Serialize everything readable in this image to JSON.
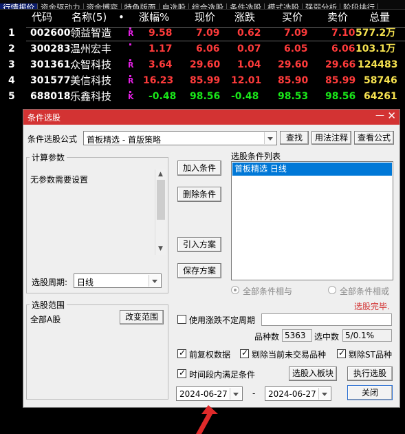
{
  "top_tabs": [
    "行情报价",
    "资金驱动力",
    "资金博弈",
    "特色版面",
    "自选股",
    "综合选股",
    "条件选股",
    "模式选股",
    "强弱分析",
    "阶段排行"
  ],
  "quote_table": {
    "headers": {
      "code": "代码",
      "name": "名称(5)",
      "dot": "•",
      "chg_pct": "涨幅%",
      "price": "现价",
      "change": "涨跌",
      "bid": "买价",
      "ask": "卖价",
      "volume": "总量"
    },
    "rows": [
      {
        "idx": "1",
        "code": "002600",
        "name": "领益智造",
        "flag": "R",
        "chg_pct": "9.58",
        "price": "7.09",
        "change": "0.62",
        "bid": "7.09",
        "ask": "7.10",
        "volume": "577.2万"
      },
      {
        "idx": "2",
        "code": "300283",
        "name": "温州宏丰",
        "flag": "",
        "chg_pct": "1.17",
        "price": "6.06",
        "change": "0.07",
        "bid": "6.05",
        "ask": "6.06",
        "volume": "103.1万"
      },
      {
        "idx": "3",
        "code": "301361",
        "name": "众智科技",
        "flag": "R",
        "chg_pct": "3.64",
        "price": "29.60",
        "change": "1.04",
        "bid": "29.60",
        "ask": "29.66",
        "volume": "124483"
      },
      {
        "idx": "4",
        "code": "301577",
        "name": "美信科技",
        "flag": "R",
        "chg_pct": "16.23",
        "price": "85.99",
        "change": "12.01",
        "bid": "85.90",
        "ask": "85.99",
        "volume": "58746"
      },
      {
        "idx": "5",
        "code": "688018",
        "name": "乐鑫科技",
        "flag": "K",
        "chg_pct": "-0.48",
        "price": "98.56",
        "change": "-0.48",
        "bid": "98.53",
        "ask": "98.56",
        "volume": "64261"
      }
    ]
  },
  "dialog": {
    "title": "条件选股",
    "minimize": "—",
    "close": "✕",
    "formula_label": "条件选股公式",
    "formula_value": "首板精选  -  首版策略",
    "find_button": "查找",
    "usage_button": "用法注释",
    "view_formula_button": "查看公式",
    "params_group": "计算参数",
    "params_text": "无参数需要设置",
    "period_label": "选股周期:",
    "period_value": "日线",
    "add_condition": "加入条件",
    "delete_condition": "删除条件",
    "import_plan": "引入方案",
    "save_plan": "保存方案",
    "condition_list_label": "选股条件列表",
    "condition_list": [
      "首板精选  日线"
    ],
    "radio_and": "全部条件相与",
    "radio_or": "全部条件相或",
    "status": "选股完毕.",
    "range_group": "选股范围",
    "range_value": "全部A股",
    "change_range": "改变范围",
    "use_uncertain_period": "使用涨跌不定周期",
    "count_label": "品种数",
    "count_value": "5363",
    "selected_label": "选中数",
    "selected_value": "5/0.1%",
    "adjust_label": "前复权数据",
    "exclude_untraded": "剔除当前未交易品种",
    "exclude_st": "剔除ST品种",
    "time_range_label": "时间段内满足条件",
    "to_block": "选股入板块",
    "execute": "执行选股",
    "date_from": "2024-06-27",
    "date_sep": "-",
    "date_to": "2024-06-27",
    "close_button": "关闭"
  },
  "colors": {
    "up": "#ff3b3b",
    "down": "#19e619",
    "title_bar": "#d33333",
    "status": "#d33333"
  }
}
